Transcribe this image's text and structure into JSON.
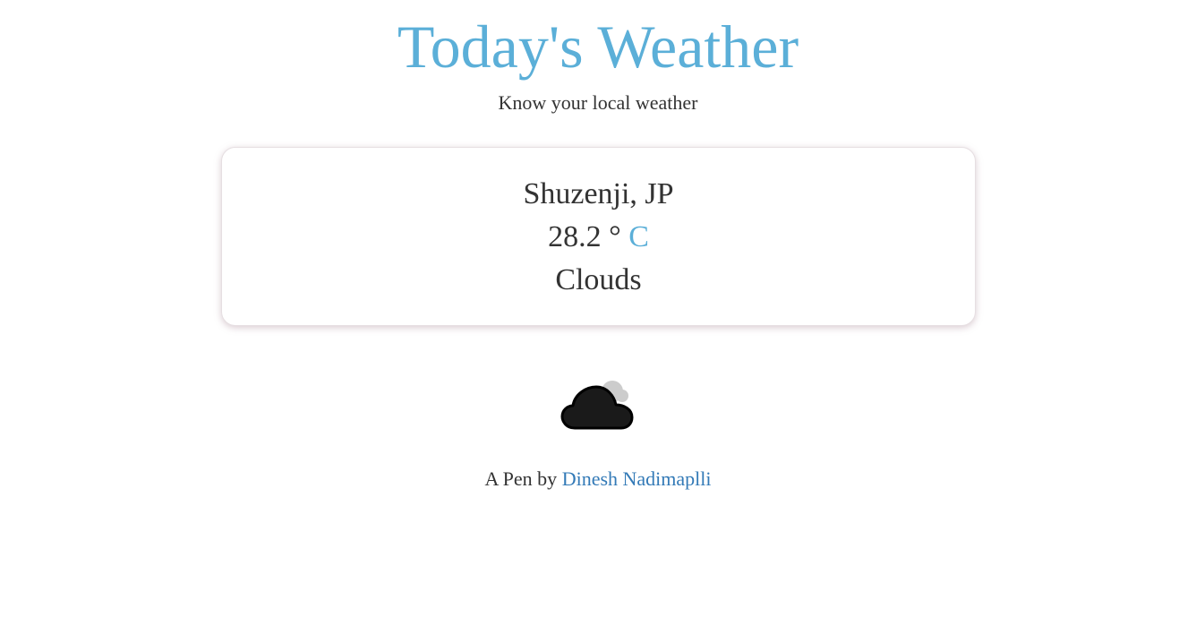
{
  "header": {
    "title": "Today's Weather",
    "subtitle": "Know your local weather"
  },
  "weather": {
    "location": "Shuzenji, JP",
    "temperature": "28.2",
    "degree_symbol": "°",
    "unit": "C",
    "condition": "Clouds",
    "icon": "cloudy-icon"
  },
  "footer": {
    "prefix": "A Pen by",
    "author_link": "Dinesh Nadimaplli"
  },
  "colors": {
    "accent": "#5bafd8",
    "text": "#333333",
    "link": "#337ab7",
    "icon_main": "#1a1a1a",
    "icon_back": "#cccccc"
  }
}
